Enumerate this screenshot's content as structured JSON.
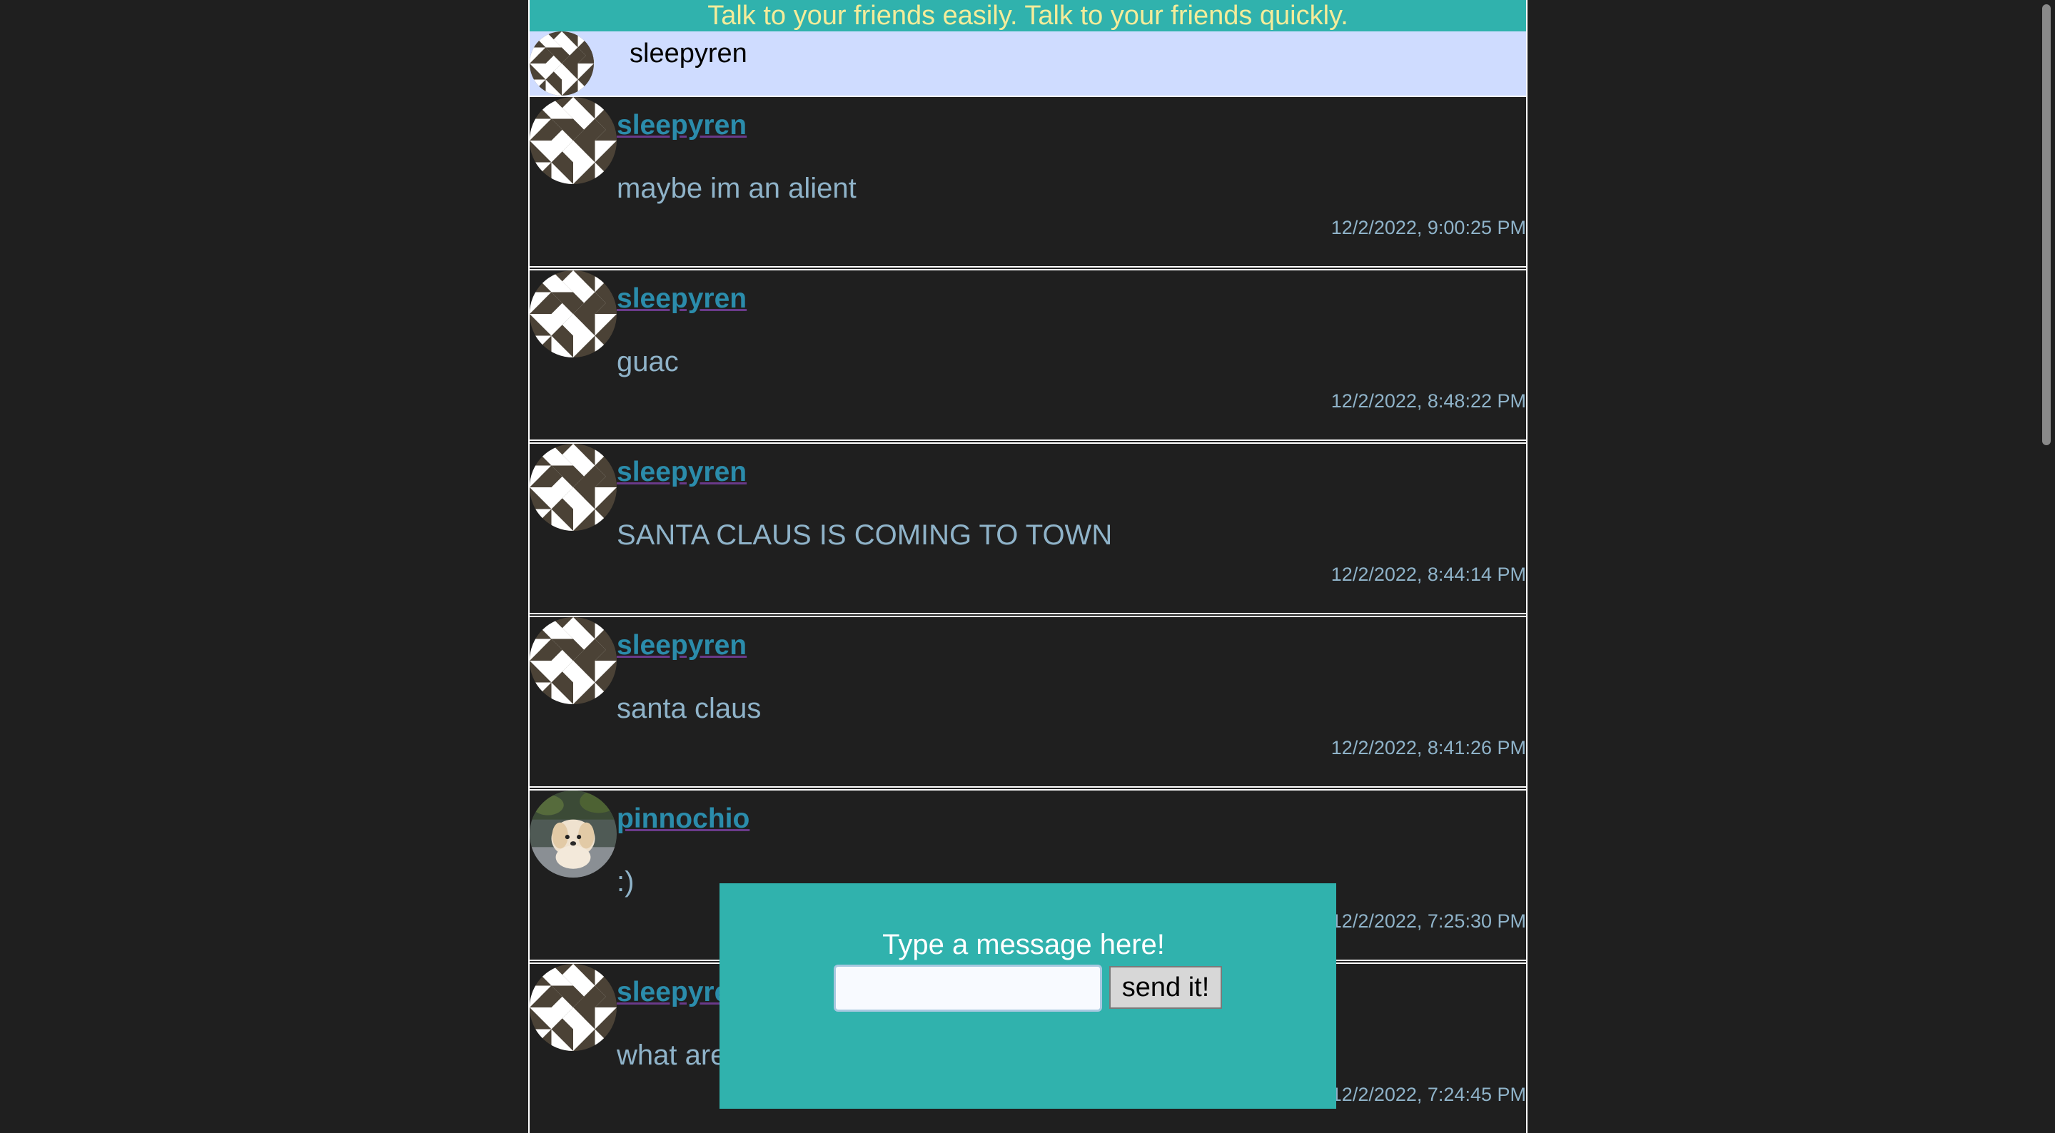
{
  "banner": {
    "text": "Talk to your friends easily. Talk to your friends quickly."
  },
  "current_user": {
    "name": "sleepyren",
    "avatar_icon": "quilt-star-avatar-icon"
  },
  "messages": [
    {
      "author": "sleepyren",
      "text": "maybe im an alient",
      "time": "12/2/2022, 9:00:25 PM",
      "avatar_icon": "quilt-star-avatar-icon"
    },
    {
      "author": "sleepyren",
      "text": "guac",
      "time": "12/2/2022, 8:48:22 PM",
      "avatar_icon": "quilt-star-avatar-icon"
    },
    {
      "author": "sleepyren",
      "text": "SANTA CLAUS IS COMING TO TOWN",
      "time": "12/2/2022, 8:44:14 PM",
      "avatar_icon": "quilt-star-avatar-icon"
    },
    {
      "author": "sleepyren",
      "text": "santa claus",
      "time": "12/2/2022, 8:41:26 PM",
      "avatar_icon": "quilt-star-avatar-icon"
    },
    {
      "author": "pinnochio",
      "text": ":)",
      "time": "12/2/2022, 7:25:30 PM",
      "avatar_icon": "puppy-photo-avatar-icon"
    },
    {
      "author": "sleepyren",
      "text": "what are",
      "time": "12/2/2022, 7:24:45 PM",
      "avatar_icon": "quilt-star-avatar-icon"
    }
  ],
  "compose": {
    "prompt": "Type a message here!",
    "input_value": "",
    "send_label": "send it!"
  },
  "colors": {
    "banner_bg": "#30b2ad",
    "banner_text": "#f4ec9a",
    "userbar_bg": "#cfdcff",
    "page_bg": "#1f1f1f",
    "author_link": "#2b8cab",
    "message_text": "#8fb3c9",
    "compose_bg": "#30b2ad"
  }
}
